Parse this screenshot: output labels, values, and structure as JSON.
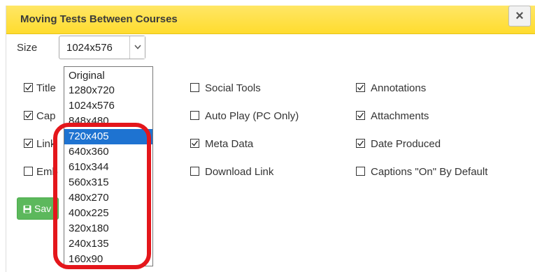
{
  "dialog": {
    "title": "Moving Tests Between Courses",
    "close_label": "×"
  },
  "size": {
    "label": "Size",
    "selected": "1024x576"
  },
  "options": [
    {
      "label": "Title",
      "checked": true
    },
    {
      "label": "Cap",
      "checked": true
    },
    {
      "label": "Link",
      "checked": true
    },
    {
      "label": "Emb",
      "checked": false
    },
    {
      "label": "Social Tools",
      "checked": false
    },
    {
      "label": "Auto Play (PC Only)",
      "checked": false
    },
    {
      "label": "Meta Data",
      "checked": true
    },
    {
      "label": "Download Link",
      "checked": false
    },
    {
      "label": "Annotations",
      "checked": true
    },
    {
      "label": "Attachments",
      "checked": true
    },
    {
      "label": "Date Produced",
      "checked": true
    },
    {
      "label": "Captions \"On\" By Default",
      "checked": false
    }
  ],
  "save_button": {
    "label": "Sav"
  },
  "dropdown": {
    "items": [
      "Original",
      "1280x720",
      "1024x576",
      "848x480",
      "720x405",
      "640x360",
      "610x344",
      "560x315",
      "480x270",
      "400x225",
      "320x180",
      "240x135",
      "160x90"
    ],
    "highlighted": "720x405"
  },
  "colors": {
    "titlebar": "#ffdc2e",
    "save_button": "#5cb85c",
    "selection": "#1e73d1",
    "annotation": "#e4161b"
  }
}
